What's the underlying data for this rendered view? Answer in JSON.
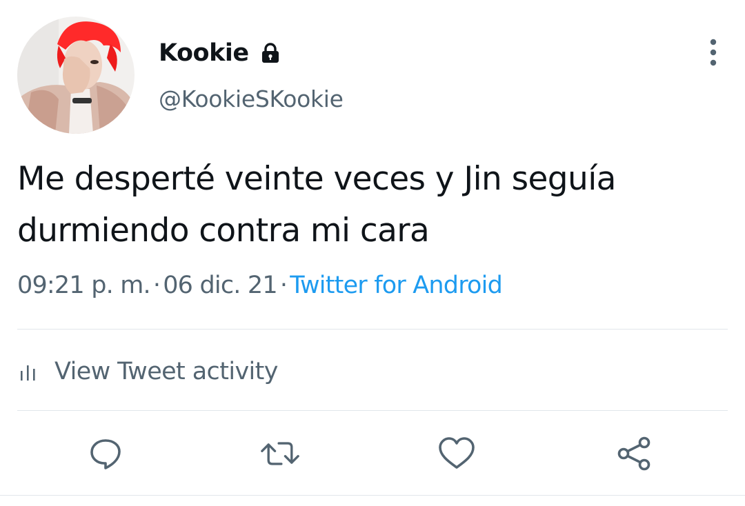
{
  "user": {
    "display_name": "Kookie",
    "handle": "@KookieSKookie",
    "protected_icon": "lock-icon",
    "avatar": "profile-photo"
  },
  "tweet": {
    "text": "Me desperté veinte veces y Jin seguía durmiendo contra mi cara"
  },
  "meta": {
    "time": "09:21 p. m.",
    "separator": "·",
    "date": "06 dic. 21",
    "source": "Twitter for Android"
  },
  "activity": {
    "label": "View Tweet activity",
    "icon": "bar-chart-icon"
  },
  "actions": [
    {
      "name": "reply",
      "icon": "reply-icon"
    },
    {
      "name": "retweet",
      "icon": "retweet-icon"
    },
    {
      "name": "like",
      "icon": "heart-icon"
    },
    {
      "name": "share",
      "icon": "share-icon"
    }
  ],
  "colors": {
    "text": "#0f1419",
    "secondary": "#536471",
    "link": "#1d9bf0",
    "divider": "#e1e6ea"
  }
}
